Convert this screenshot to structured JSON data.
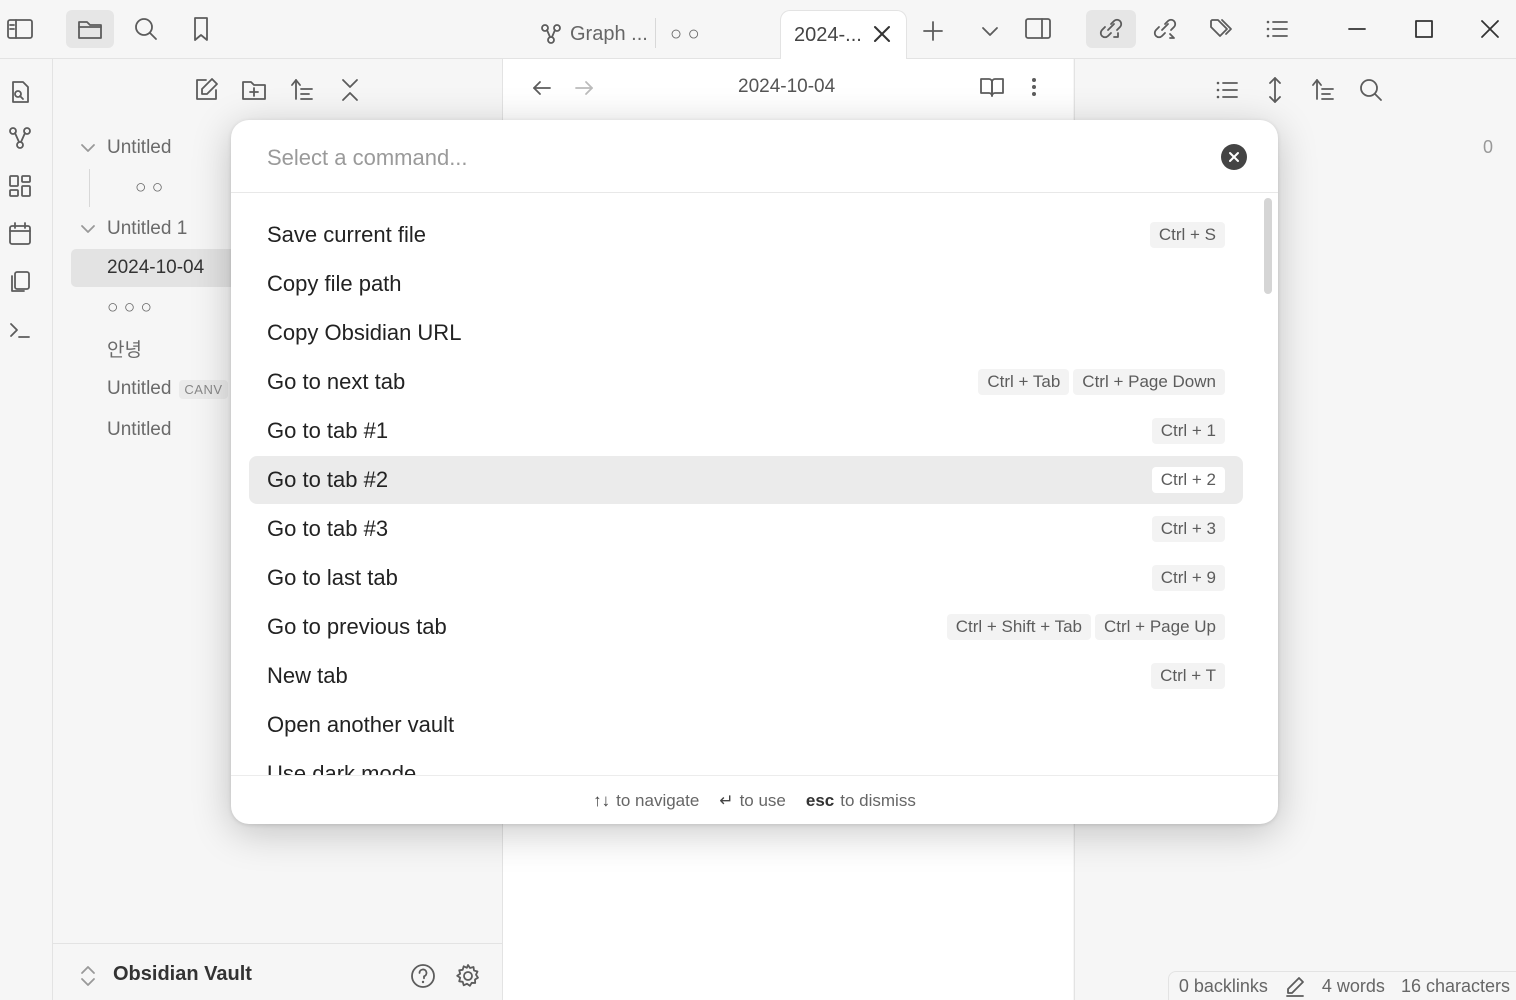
{
  "window": {
    "tabs": [
      {
        "label": "Graph ...",
        "icon": "graph-icon"
      },
      {
        "label": "○ ○",
        "icon": ""
      },
      {
        "label": "2024-...",
        "icon": ""
      }
    ]
  },
  "file_explorer": {
    "items": [
      {
        "label": "Untitled",
        "type": "folder-open"
      },
      {
        "label": "○ ○",
        "type": "file"
      },
      {
        "label": "Untitled 1",
        "type": "folder-open"
      },
      {
        "label": "2024-10-04",
        "type": "file",
        "selected": true
      },
      {
        "label": "○ ○ ○",
        "type": "file"
      },
      {
        "label": "안녕",
        "type": "file"
      },
      {
        "label": "Untitled",
        "type": "file",
        "badge": "CANV"
      },
      {
        "label": "Untitled",
        "type": "file"
      }
    ],
    "vault_name": "Obsidian Vault"
  },
  "editor": {
    "title": "2024-10-04"
  },
  "right_panel": {
    "count": "0"
  },
  "command_palette": {
    "placeholder": "Select a command...",
    "commands": [
      {
        "label": "Save current file",
        "hotkeys": [
          "Ctrl + S"
        ]
      },
      {
        "label": "Copy file path",
        "hotkeys": []
      },
      {
        "label": "Copy Obsidian URL",
        "hotkeys": []
      },
      {
        "label": "Go to next tab",
        "hotkeys": [
          "Ctrl + Tab",
          "Ctrl + Page Down"
        ]
      },
      {
        "label": "Go to tab #1",
        "hotkeys": [
          "Ctrl + 1"
        ]
      },
      {
        "label": "Go to tab #2",
        "hotkeys": [
          "Ctrl + 2"
        ],
        "selected": true
      },
      {
        "label": "Go to tab #3",
        "hotkeys": [
          "Ctrl + 3"
        ]
      },
      {
        "label": "Go to last tab",
        "hotkeys": [
          "Ctrl + 9"
        ]
      },
      {
        "label": "Go to previous tab",
        "hotkeys": [
          "Ctrl + Shift + Tab",
          "Ctrl + Page Up"
        ]
      },
      {
        "label": "New tab",
        "hotkeys": [
          "Ctrl + T"
        ]
      },
      {
        "label": "Open another vault",
        "hotkeys": []
      },
      {
        "label": "Use dark mode",
        "hotkeys": []
      }
    ],
    "instructions": [
      {
        "key": "↑↓",
        "text": "to navigate"
      },
      {
        "key": "↵",
        "text": "to use"
      },
      {
        "key": "esc",
        "text": "to dismiss"
      }
    ]
  },
  "status_bar": {
    "backlinks": "0 backlinks",
    "words": "4 words",
    "characters": "16 characters"
  }
}
